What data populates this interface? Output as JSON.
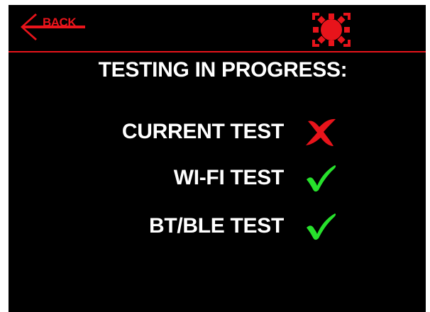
{
  "header": {
    "back_label": "BACK",
    "settings_icon": "gear-icon"
  },
  "title": "TESTING IN PROGRESS:",
  "tests": [
    {
      "label": "CURRENT TEST",
      "status": "fail",
      "icon": "cross-icon"
    },
    {
      "label": "WI-FI TEST",
      "status": "pass",
      "icon": "check-icon"
    },
    {
      "label": "BT/BLE TEST",
      "status": "pass",
      "icon": "check-icon"
    }
  ],
  "colors": {
    "accent": "#e8141b",
    "background": "#000000",
    "text": "#ffffff",
    "pass": "#27e12c",
    "fail": "#e8141b"
  }
}
